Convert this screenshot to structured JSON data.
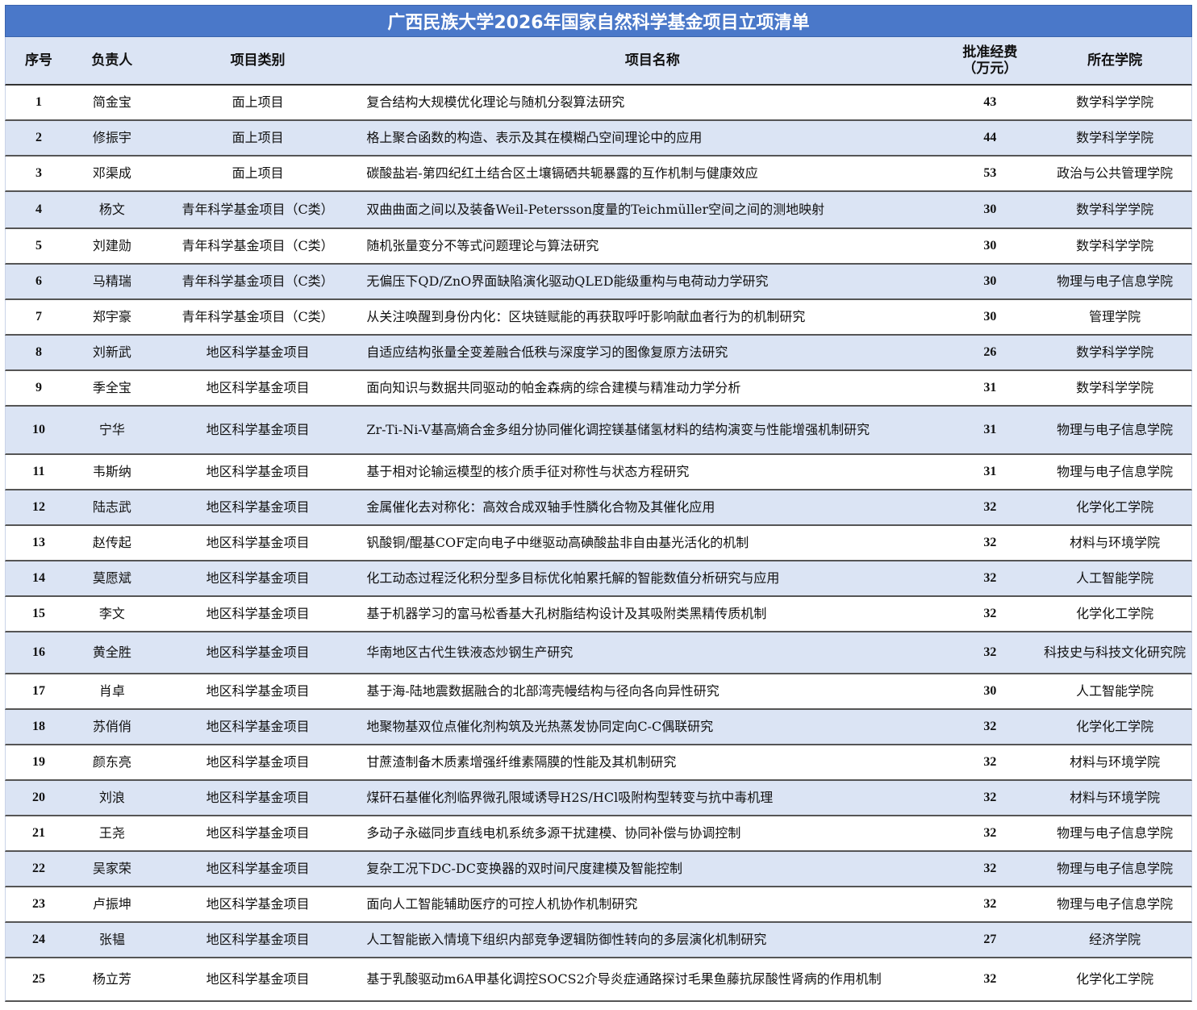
{
  "title": "广西民族大学2026年国家自然科学基金项目立项清单",
  "headers": {
    "no": "序号",
    "leader": "负责人",
    "category": "项目类别",
    "name": "项目名称",
    "funding_line1": "批准经费",
    "funding_line2": "（万元）",
    "college": "所在学院"
  },
  "rows": [
    {
      "no": "1",
      "leader": "简金宝",
      "category": "面上项目",
      "name": "复合结构大规模优化理论与随机分裂算法研究",
      "funding": "43",
      "college": "数学科学学院"
    },
    {
      "no": "2",
      "leader": "修振宇",
      "category": "面上项目",
      "name": "格上聚合函数的构造、表示及其在模糊凸空间理论中的应用",
      "funding": "44",
      "college": "数学科学学院"
    },
    {
      "no": "3",
      "leader": "邓渠成",
      "category": "面上项目",
      "name": "碳酸盐岩-第四纪红土结合区土壤镉硒共轭暴露的互作机制与健康效应",
      "funding": "53",
      "college": "政治与公共管理学院"
    },
    {
      "no": "4",
      "leader": "杨文",
      "category": "青年科学基金项目（C类）",
      "name": "双曲曲面之间以及装备Weil-Petersson度量的Teichmüller空间之间的测地映射",
      "funding": "30",
      "college": "数学科学学院"
    },
    {
      "no": "5",
      "leader": "刘建勋",
      "category": "青年科学基金项目（C类）",
      "name": "随机张量变分不等式问题理论与算法研究",
      "funding": "30",
      "college": "数学科学学院"
    },
    {
      "no": "6",
      "leader": "马精瑞",
      "category": "青年科学基金项目（C类）",
      "name": "无偏压下QD/ZnO界面缺陷演化驱动QLED能级重构与电荷动力学研究",
      "funding": "30",
      "college": "物理与电子信息学院"
    },
    {
      "no": "7",
      "leader": "郑宇豪",
      "category": "青年科学基金项目（C类）",
      "name": "从关注唤醒到身份内化：区块链赋能的再获取呼吁影响献血者行为的机制研究",
      "funding": "30",
      "college": "管理学院"
    },
    {
      "no": "8",
      "leader": "刘新武",
      "category": "地区科学基金项目",
      "name": "自适应结构张量全变差融合低秩与深度学习的图像复原方法研究",
      "funding": "26",
      "college": "数学科学学院"
    },
    {
      "no": "9",
      "leader": "季全宝",
      "category": "地区科学基金项目",
      "name": "面向知识与数据共同驱动的帕金森病的综合建模与精准动力学分析",
      "funding": "31",
      "college": "数学科学学院"
    },
    {
      "no": "10",
      "leader": "宁华",
      "category": "地区科学基金项目",
      "name": "Zr-Ti-Ni-V基高熵合金多组分协同催化调控镁基储氢材料的结构演变与性能增强机制研究",
      "funding": "31",
      "college": "物理与电子信息学院"
    },
    {
      "no": "11",
      "leader": "韦斯纳",
      "category": "地区科学基金项目",
      "name": "基于相对论输运模型的核介质手征对称性与状态方程研究",
      "funding": "31",
      "college": "物理与电子信息学院"
    },
    {
      "no": "12",
      "leader": "陆志武",
      "category": "地区科学基金项目",
      "name": "金属催化去对称化：高效合成双轴手性膦化合物及其催化应用",
      "funding": "32",
      "college": "化学化工学院"
    },
    {
      "no": "13",
      "leader": "赵传起",
      "category": "地区科学基金项目",
      "name": "钒酸铜/醌基COF定向电子中继驱动高碘酸盐非自由基光活化的机制",
      "funding": "32",
      "college": "材料与环境学院"
    },
    {
      "no": "14",
      "leader": "莫愿斌",
      "category": "地区科学基金项目",
      "name": "化工动态过程泛化积分型多目标优化帕累托解的智能数值分析研究与应用",
      "funding": "32",
      "college": "人工智能学院"
    },
    {
      "no": "15",
      "leader": "李文",
      "category": "地区科学基金项目",
      "name": "基于机器学习的富马松香基大孔树脂结构设计及其吸附类黑精传质机制",
      "funding": "32",
      "college": "化学化工学院"
    },
    {
      "no": "16",
      "leader": "黄全胜",
      "category": "地区科学基金项目",
      "name": "华南地区古代生铁液态炒钢生产研究",
      "funding": "32",
      "college": "科技史与科技文化研究院"
    },
    {
      "no": "17",
      "leader": "肖卓",
      "category": "地区科学基金项目",
      "name": "基于海-陆地震数据融合的北部湾壳幔结构与径向各向异性研究",
      "funding": "30",
      "college": "人工智能学院"
    },
    {
      "no": "18",
      "leader": "苏俏俏",
      "category": "地区科学基金项目",
      "name": "地聚物基双位点催化剂构筑及光热蒸发协同定向C-C偶联研究",
      "funding": "32",
      "college": "化学化工学院"
    },
    {
      "no": "19",
      "leader": "颜东亮",
      "category": "地区科学基金项目",
      "name": "甘蔗渣制备木质素增强纤维素隔膜的性能及其机制研究",
      "funding": "32",
      "college": "材料与环境学院"
    },
    {
      "no": "20",
      "leader": "刘浪",
      "category": "地区科学基金项目",
      "name": "煤矸石基催化剂临界微孔限域诱导H2S/HCl吸附构型转变与抗中毒机理",
      "funding": "32",
      "college": "材料与环境学院"
    },
    {
      "no": "21",
      "leader": "王尧",
      "category": "地区科学基金项目",
      "name": "多动子永磁同步直线电机系统多源干扰建模、协同补偿与协调控制",
      "funding": "32",
      "college": "物理与电子信息学院"
    },
    {
      "no": "22",
      "leader": "吴家荣",
      "category": "地区科学基金项目",
      "name": "复杂工况下DC-DC变换器的双时间尺度建模及智能控制",
      "funding": "32",
      "college": "物理与电子信息学院"
    },
    {
      "no": "23",
      "leader": "卢振坤",
      "category": "地区科学基金项目",
      "name": "面向人工智能辅助医疗的可控人机协作机制研究",
      "funding": "32",
      "college": "物理与电子信息学院"
    },
    {
      "no": "24",
      "leader": "张韫",
      "category": "地区科学基金项目",
      "name": "人工智能嵌入情境下组织内部竞争逻辑防御性转向的多层演化机制研究",
      "funding": "27",
      "college": "经济学院"
    },
    {
      "no": "25",
      "leader": "杨立芳",
      "category": "地区科学基金项目",
      "name": "基于乳酸驱动m6A甲基化调控SOCS2介导炎症通路探讨毛果鱼藤抗尿酸性肾病的作用机制",
      "funding": "32",
      "college": "化学化工学院"
    }
  ]
}
